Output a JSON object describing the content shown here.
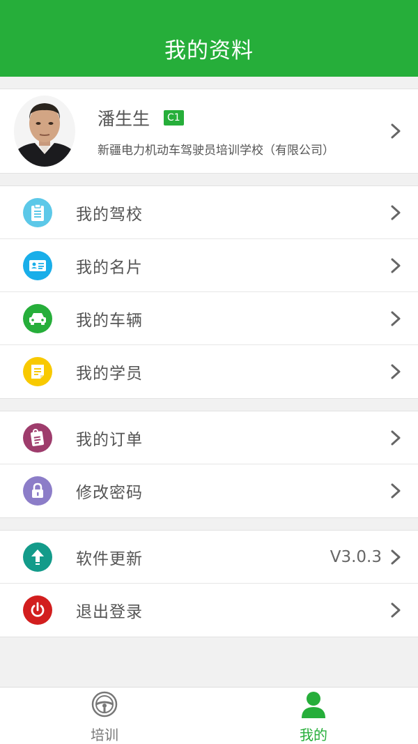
{
  "header": {
    "title": "我的资料"
  },
  "profile": {
    "name": "潘生生",
    "license_badge": "C1",
    "school": "新疆电力机动车驾驶员培训学校（有限公司）"
  },
  "groups": [
    {
      "items": [
        {
          "label": "我的驾校",
          "icon": "clipboard-icon",
          "color": "#5cc8e8"
        },
        {
          "label": "我的名片",
          "icon": "id-card-icon",
          "color": "#19aee9"
        },
        {
          "label": "我的车辆",
          "icon": "car-icon",
          "color": "#26ae3a"
        },
        {
          "label": "我的学员",
          "icon": "notes-icon",
          "color": "#f8c900"
        }
      ]
    },
    {
      "items": [
        {
          "label": "我的订单",
          "icon": "order-icon",
          "color": "#9e3c6c"
        },
        {
          "label": "修改密码",
          "icon": "lock-icon",
          "color": "#8c7dc8"
        }
      ]
    },
    {
      "items": [
        {
          "label": "软件更新",
          "icon": "upload-icon",
          "color": "#139b8a",
          "value": "V3.0.3"
        },
        {
          "label": "退出登录",
          "icon": "power-icon",
          "color": "#d21e1e"
        }
      ]
    }
  ],
  "tabbar": {
    "tabs": [
      {
        "label": "培训",
        "active": false
      },
      {
        "label": "我的",
        "active": true
      }
    ]
  },
  "colors": {
    "brand": "#26ae3a"
  }
}
